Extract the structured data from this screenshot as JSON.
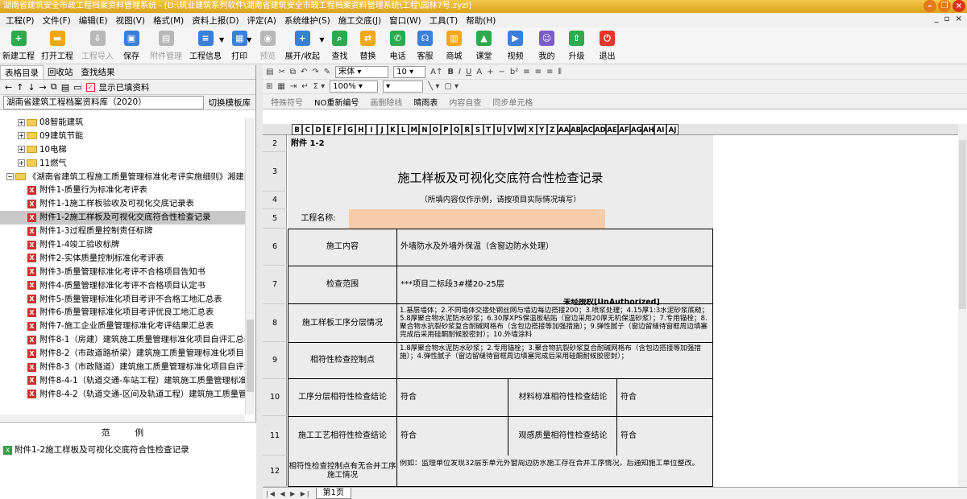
{
  "window": {
    "title": "湖南省建筑安全市政工程档案资料管理系统 - [D:\\筑业建筑系列软件\\湖南省建筑安全市政工程档案资料管理系统\\工程\\园林7号.zyzl]"
  },
  "menu": [
    "工程(P)",
    "文件(F)",
    "编辑(E)",
    "视图(V)",
    "格式(M)",
    "资料上报(D)",
    "评定(A)",
    "系统维护(S)",
    "施工交底(J)",
    "窗口(W)",
    "工具(T)",
    "帮助(H)"
  ],
  "toolbar": {
    "new": "新建工程",
    "open": "打开工程",
    "import": "工程导入",
    "save": "保存",
    "attach": "附件管理",
    "info": "工程信息",
    "print": "打印",
    "preview": "预览",
    "expand": "展开/收起",
    "find": "查找",
    "replace": "替换",
    "phone": "电话",
    "service": "客服",
    "mall": "商城",
    "classroom": "课堂",
    "video": "视频",
    "mine": "我的",
    "upgrade": "升级",
    "exit": "退出"
  },
  "left": {
    "tabs": [
      "表格目录",
      "回收站",
      "查找结果"
    ],
    "show_filled": "显示已填资料",
    "library": "湖南省建筑工程档案资料库（2020）",
    "switch_template": "切换模板库",
    "tree": [
      {
        "label": "08智能建筑",
        "type": "folder"
      },
      {
        "label": "09建筑节能",
        "type": "folder"
      },
      {
        "label": "10电梯",
        "type": "folder"
      },
      {
        "label": "11燃气",
        "type": "folder"
      },
      {
        "label": "《湖南省建筑工程施工质量管理标准化考评实施细则》湘建建",
        "type": "root"
      },
      {
        "label": "附件1-质量行为标准化考评表",
        "type": "doc"
      },
      {
        "label": "附件1-1施工样板验收及可视化交底记录表",
        "type": "doc"
      },
      {
        "label": "附件1-2施工样板及可视化交底符合性检查记录",
        "type": "doc",
        "selected": true
      },
      {
        "label": "附件1-3过程质量控制责任标牌",
        "type": "doc"
      },
      {
        "label": "附件1-4竣工验收标牌",
        "type": "doc"
      },
      {
        "label": "附件2-实体质量控制标准化考评表",
        "type": "doc"
      },
      {
        "label": "附件3-质量管理标准化考评不合格项目告知书",
        "type": "doc"
      },
      {
        "label": "附件4-质量管理标准化考评不合格项目认定书",
        "type": "doc"
      },
      {
        "label": "附件5-质量管理标准化项目考评不合格工地汇总表",
        "type": "doc"
      },
      {
        "label": "附件6-质量管理标准化项目考评优良工地汇总表",
        "type": "doc"
      },
      {
        "label": "附件7-施工企业质量管理标准化考评结果汇总表",
        "type": "doc"
      },
      {
        "label": "附件8-1（房建）建筑施工质量管理标准化项目自评汇总表",
        "type": "doc"
      },
      {
        "label": "附件8-2（市政道路桥梁）建筑施工质量管理标准化项目自",
        "type": "doc"
      },
      {
        "label": "附件8-3（市政隧道）建筑施工质量管理标准化项目自评汇",
        "type": "doc"
      },
      {
        "label": "附件8-4-1（轨道交通-车站工程）建筑施工质量管理标准化",
        "type": "doc"
      },
      {
        "label": "附件8-4-2（轨道交通-区间及轨道工程）建筑施工质量管理",
        "type": "doc"
      }
    ],
    "legend_title": "范 例",
    "legend_item": "附件1-2施工样板及可视化交底符合性检查记录"
  },
  "format": {
    "font": "宋体",
    "size": "10",
    "zoom": "100%"
  },
  "format2": [
    "特殊符号",
    "NO重新编号",
    "画删除线",
    "晴雨表",
    "内容自查",
    "同步单元格"
  ],
  "columns": [
    "B",
    "C",
    "D",
    "E",
    "F",
    "G",
    "H",
    "I",
    "J",
    "K",
    "L",
    "M",
    "N",
    "O",
    "P",
    "Q",
    "R",
    "S",
    "T",
    "U",
    "V",
    "W",
    "X",
    "Y",
    "Z",
    "AA",
    "AB",
    "AC",
    "AD",
    "AE",
    "AF",
    "AG",
    "AH",
    "AI",
    "AJ"
  ],
  "rows": [
    "2",
    "3",
    "4",
    "5",
    "6",
    "7",
    "8",
    "9",
    "10",
    "11",
    "12"
  ],
  "sheet": {
    "attach_no": "附件 1-2",
    "title": "施工样板及可视化交底符合性检查记录",
    "subtitle": "（所填内容仅作示例，请按项目实际情况填写）",
    "project_label": "工程名称:",
    "watermark": "未经授权[UnAuthorized]",
    "r6_label": "施工内容",
    "r6_value": "外墙防水及外墙外保温（含窗边防水处理）",
    "r7_label": "检查范围",
    "r7_value": "***项目二标段3#楼20-25层",
    "r8_label": "施工样板工序分层情况",
    "r8_value": "1.基层墙体；2.不同墙体交接处钢丝网与墙边每边搭接200；3.喷浆处理；4.15厚1:3水泥砂浆底糙；5.8厚聚合物水泥防水砂浆；6.30厚XPS保温板粘贴（窗边采用20厚无机保温砂浆）；7.专用锚栓；8.聚合物水抗裂砂浆复合耐碱网格布（含包边搭接等加强措施）；9.弹性腻子（窗边留缝待窗框周边填塞完成后采用硅酮耐候胶密封）；10.外墙涂料",
    "r9_label": "相符性检查控制点",
    "r9_value": "1.8厚聚合物水泥防水砂浆；2.专用锚栓；3.聚合物抗裂砂浆复合耐碱网格布（含包边搭接等加强措施）；4.弹性腻子（窗边留缝待窗框周边填塞完成后采用硅酮耐候胶密封）；",
    "r10_label": "工序分层相符性检查结论",
    "r10_value": "符合",
    "r10_label2": "材料标准相符性检查结论",
    "r10_value2": "符合",
    "r11_label": "施工工艺相符性检查结论",
    "r11_value": "符合",
    "r11_label2": "观感质量相符性检查结论",
    "r11_value2": "符合",
    "r12_label": "相符性检查控制点有无合并工序施工情况",
    "r12_value": "例如：监理单位发现32层东单元外窗周边防水施工存在合并工序情况，后通知施工单位整改。"
  },
  "sheet_tab": "第1页"
}
